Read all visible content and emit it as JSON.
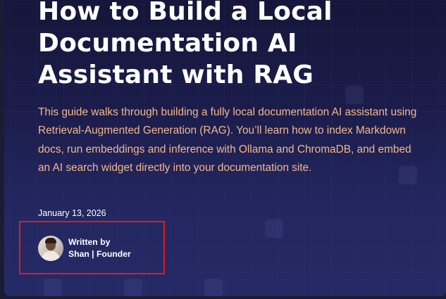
{
  "article": {
    "title": "How to Build a Local Documentation AI Assistant with RAG",
    "description": "This guide walks through building a fully local documentation AI assistant using Retrieval-Augmented Generation (RAG). You’ll learn how to index Markdown docs, run embeddings and inference with Ollama and ChromaDB, and embed an AI search widget directly into your documentation site.",
    "date": "January 13, 2026",
    "author": {
      "written_by_label": "Written by",
      "name": "Shan | Founder"
    }
  },
  "colors": {
    "description_text": "#f2b78e",
    "highlight_border": "#e01b22",
    "title_text": "#ffffff"
  }
}
